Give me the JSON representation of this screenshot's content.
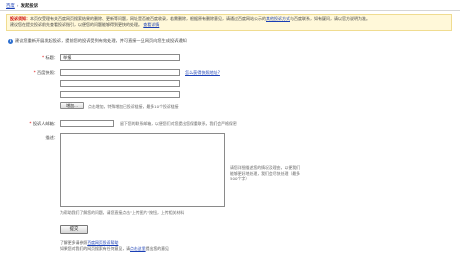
{
  "breadcrumb": {
    "home": "百度",
    "separator": "›",
    "current": "发起投诉"
  },
  "notice": {
    "title": "投诉须知：",
    "text": "本页仅受理有关百度网页搜索结果的删除、更新等问题，网址是否被百度收录，若需删除，根据原有删除意见，请通过百度网站公示的",
    "link1": "其他投诉方式",
    "text2": "与百度联系，如有疑问，请以官方说明为准。",
    "text3": "建议您在提交投诉前先查看投诉指引，以便您的问题能够得到更快的处理。",
    "link2": "查看详情"
  },
  "tip": {
    "icon": "info-icon",
    "text": "建议您重新开展发起投诉，提前您的投诉受到有效处理，并可直接一旦网页向您生成投诉通知"
  },
  "form": {
    "title_label": "标题：",
    "title_value": "举报",
    "url_label": "百度快照：",
    "url_link": "怎么获得快照地址?",
    "add_button": "增加...",
    "add_hint": "点击增加，特殊增加已投诉链接，最多10个投诉链接",
    "email_label": "投诉人邮箱：",
    "email_hint": "留下您的联系邮箱，以便您们对您提出您保重联系，我们会严格保密",
    "desc_label": "描述：",
    "desc_hint": "请您详细描述您的情况及理由，以便我们能够更好地处理，我们会尽快处理（最多500个字）",
    "upload_hint": "为帮助我们了解您的问题，请您直接点击\"上传图片\"按钮，上传相关材料",
    "submit": "提交"
  },
  "footer": {
    "line1_prefix": "了解更多请参照",
    "line1_link": "百度网页投诉帮助",
    "line2_prefix": "如果您对我们的网页搜索有任何意见，请",
    "line2_link": "点击这里",
    "line2_suffix": "提出您的意见"
  }
}
